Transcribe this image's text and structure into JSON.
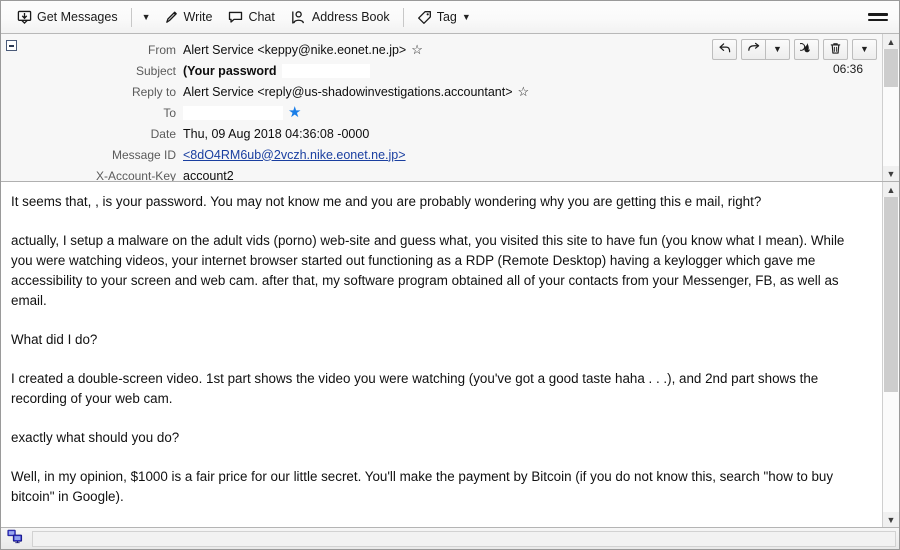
{
  "toolbar": {
    "get_messages": "Get Messages",
    "write": "Write",
    "chat": "Chat",
    "address_book": "Address Book",
    "tag": "Tag"
  },
  "header": {
    "labels": {
      "from": "From",
      "subject": "Subject",
      "reply_to": "Reply to",
      "to": "To",
      "date": "Date",
      "message_id": "Message ID",
      "x_account_key": "X-Account-Key"
    },
    "values": {
      "from": "Alert Service <keppy@nike.eonet.ne.jp>",
      "subject": "(Your password",
      "reply_to": "Alert Service <reply@us-shadowinvestigations.accountant>",
      "to": "",
      "date": "Thu, 09 Aug 2018 04:36:08 -0000",
      "message_id": "<8dO4RM6ub@2vczh.nike.eonet.ne.jp>",
      "x_account_key": "account2"
    },
    "time": "06:36",
    "actions": {
      "reply": "reply-arrow",
      "forward": "forward-arrow",
      "forward_more": "chevron-down",
      "junk": "flame",
      "delete": "trash",
      "more": "chevron-down"
    }
  },
  "body": {
    "paragraphs": [
      "It seems that,                    , is your password. You may not know me and you are probably wondering why you are getting this e mail, right?",
      "actually, I setup a malware on the adult vids (porno) web-site and guess what, you visited this site to have fun (you know what I mean). While you were watching videos, your internet browser started out functioning as a RDP (Remote Desktop) having a keylogger which gave me accessibility to your screen and web cam. after that, my software program obtained all of your contacts from your Messenger, FB, as well as email.",
      "What did I do?",
      "I created a double-screen video. 1st part shows the video you were watching (you've got a good taste haha . . .), and 2nd part shows the recording of your web cam.",
      "exactly what should you do?",
      "Well, in my opinion, $1000 is a fair price for our little secret. You'll make the payment by Bitcoin (if you do not know this, search \"how to buy bitcoin\" in Google)."
    ]
  },
  "colors": {
    "link": "#1a3fa0",
    "star_filled": "#1a7ee8",
    "toolbar_bg": "#fafafa",
    "header_bg": "#f7f7f7"
  }
}
